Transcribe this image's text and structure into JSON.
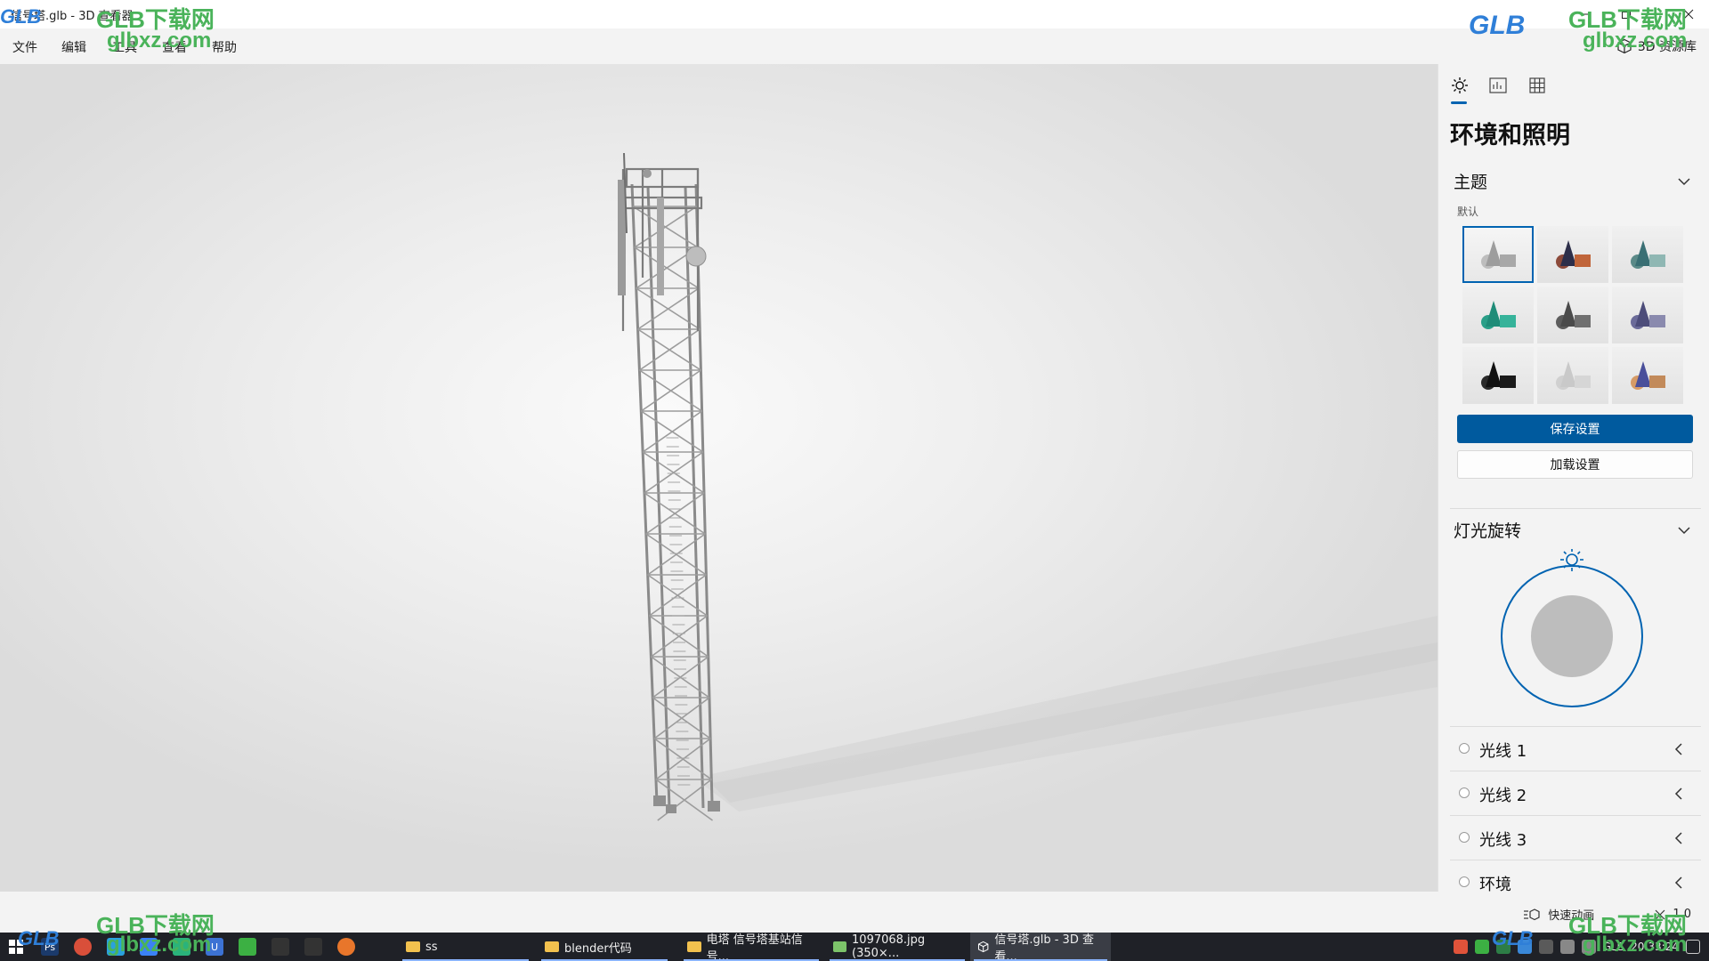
{
  "window": {
    "title": "信号塔.glb - 3D 查看器",
    "minimize_icon": "minimize-icon",
    "restore_icon": "restore-icon",
    "close_icon": "close-icon"
  },
  "menu": {
    "items": [
      "文件",
      "编辑",
      "工具",
      "查看",
      "帮助"
    ],
    "library_label": "3D 资源库"
  },
  "panel": {
    "tabs": [
      "sun-icon",
      "stats-icon",
      "grid-icon"
    ],
    "title": "环境和照明",
    "theme_section": "主题",
    "theme_sub": "默认",
    "themes": [
      {
        "cone": "#9d9d9d",
        "cube": "#a8a8a8",
        "sphere": "#bdbdbd"
      },
      {
        "cone": "#2d2f4a",
        "cube": "#c0653a",
        "sphere": "#8c4a3a"
      },
      {
        "cone": "#3a6f74",
        "cube": "#8fb7b3",
        "sphere": "#5b8a88"
      },
      {
        "cone": "#1f8c78",
        "cube": "#36b39a",
        "sphere": "#2a9f88"
      },
      {
        "cone": "#4b4b4b",
        "cube": "#707070",
        "sphere": "#5d5d5d"
      },
      {
        "cone": "#4d4d7a",
        "cube": "#8a8aae",
        "sphere": "#6b6b99"
      },
      {
        "cone": "#111111",
        "cube": "#1b1b1b",
        "sphere": "#2a2a2a"
      },
      {
        "cone": "#c9c9c9",
        "cube": "#d6d6d6",
        "sphere": "#d0d0d0"
      },
      {
        "cone": "#4a4f9a",
        "cube": "#c28a5a",
        "sphere": "#d69a66"
      }
    ],
    "save_label": "保存设置",
    "load_label": "加载设置",
    "light_section": "灯光旋转",
    "lights": [
      "光线 1",
      "光线 2",
      "光线 3",
      "环境"
    ],
    "accent": "#0063b1"
  },
  "status": {
    "anim_label": "快速动画",
    "speed": "1.0"
  },
  "taskbar": {
    "tasks": [
      {
        "label": "ss",
        "icon": "folder-icon"
      },
      {
        "label": "blender代码",
        "icon": "folder-icon"
      },
      {
        "label": "电塔 信号塔基站信号...",
        "icon": "folder-icon"
      },
      {
        "label": "1097068.jpg (350×...",
        "icon": "image-icon"
      },
      {
        "label": "信号塔.glb - 3D 查看...",
        "icon": "cube-icon"
      }
    ],
    "clock": "20:33:24",
    "tray_text": "GLE"
  },
  "watermark": {
    "cn": "GLB下载网",
    "url": "glbxz.com",
    "logo": "GLB"
  }
}
